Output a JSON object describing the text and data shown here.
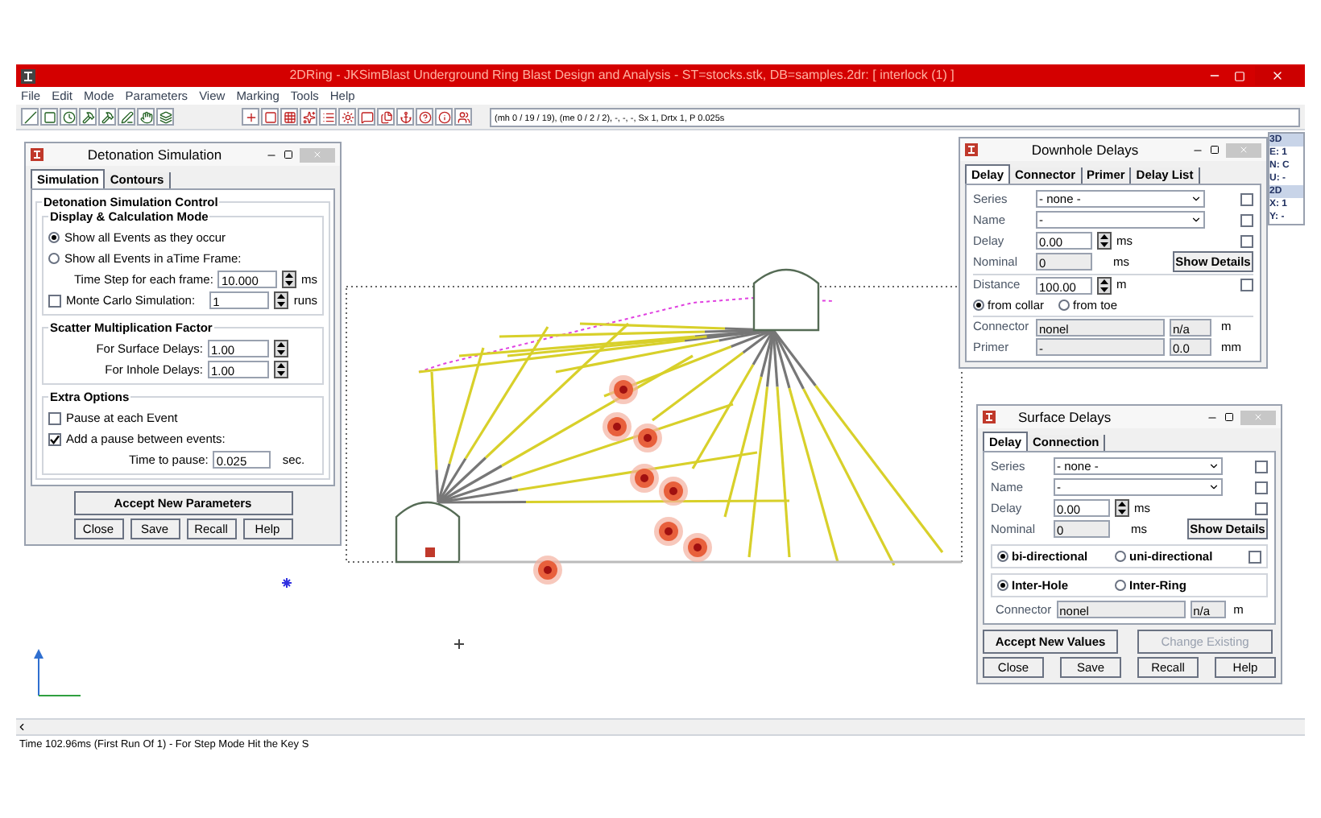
{
  "window": {
    "title": "2DRing - JKSimBlast Underground Ring Blast Design and Analysis - ST=stocks.stk, DB=samples.2dr: [ interlock (1) ]"
  },
  "menu": [
    "File",
    "Edit",
    "Mode",
    "Parameters",
    "View",
    "Marking",
    "Tools",
    "Help"
  ],
  "toolbar": {
    "status": "(mh 0 / 19 / 19), (me 0 / 2 / 2), -, -, -, Sx 1, Drtx 1, P 0.025s"
  },
  "coordinate_panel": {
    "lines": [
      {
        "text": "3D",
        "kind": "header"
      },
      {
        "text": "E: 1",
        "kind": "line"
      },
      {
        "text": "N: C",
        "kind": "line"
      },
      {
        "text": "U: -",
        "kind": "line"
      },
      {
        "text": "2D",
        "kind": "header"
      },
      {
        "text": "X: 1",
        "kind": "line"
      },
      {
        "text": "Y: -",
        "kind": "line"
      }
    ]
  },
  "detonation": {
    "title": "Detonation Simulation",
    "tabs": [
      {
        "label": "Simulation",
        "selected": true
      },
      {
        "label": "Contours",
        "selected": false
      }
    ],
    "group_title": "Detonation Simulation Control",
    "mode": {
      "title": "Display & Calculation  Mode",
      "options": [
        {
          "label": "Show all Events as they occur",
          "selected": true
        },
        {
          "label": "Show all Events in aTime Frame:",
          "selected": false
        }
      ]
    },
    "time_step": {
      "label": "Time Step for each frame:",
      "value": "10.000",
      "unit": "ms"
    },
    "monte_carlo": {
      "label": "Monte Carlo Simulation:",
      "checked": false,
      "value": "1",
      "unit": "runs"
    },
    "scatter": {
      "title": "Scatter Multiplication Factor",
      "rows": [
        {
          "label": "For Surface Delays:",
          "value": "1.00"
        },
        {
          "label": "For Inhole Delays:",
          "value": "1.00"
        }
      ]
    },
    "extra": {
      "title": "Extra Options",
      "checks": [
        {
          "label": "Pause at each Event",
          "checked": false
        },
        {
          "label": "Add a pause between events:",
          "checked": true
        }
      ],
      "time_to_pause": {
        "label": "Time to pause:",
        "value": "0.025",
        "unit": "sec."
      }
    },
    "accept": "Accept New Parameters",
    "buttons": [
      "Close",
      "Save",
      "Recall",
      "Help"
    ]
  },
  "downhole": {
    "title": "Downhole Delays",
    "tabs": [
      {
        "label": "Delay",
        "selected": true
      },
      {
        "label": "Connector",
        "selected": false
      },
      {
        "label": "Primer",
        "selected": false
      },
      {
        "label": "Delay List",
        "selected": false
      }
    ],
    "series": {
      "label": "Series",
      "value": "- none -",
      "checked": false
    },
    "name": {
      "label": "Name",
      "value": "-",
      "checked": false
    },
    "delay": {
      "label": "Delay",
      "value": "0.00",
      "unit": "ms",
      "checked": false
    },
    "nominal": {
      "label": "Nominal",
      "value": "0",
      "unit": "ms"
    },
    "show_details": "Show Details",
    "distance": {
      "label": "Distance",
      "value": "100.00",
      "unit": "m",
      "checked": false
    },
    "from": [
      {
        "label": "from collar",
        "selected": true
      },
      {
        "label": "from toe",
        "selected": false
      }
    ],
    "connector": {
      "label": "Connector",
      "value": "nonel",
      "extra": "n/a",
      "unit": "m"
    },
    "primer": {
      "label": "Primer",
      "value": "-",
      "extra": "0.0",
      "unit": "mm"
    }
  },
  "surface": {
    "title": "Surface Delays",
    "tabs": [
      {
        "label": "Delay",
        "selected": true
      },
      {
        "label": "Connection",
        "selected": false
      }
    ],
    "series": {
      "label": "Series",
      "value": "- none -",
      "checked": false
    },
    "name": {
      "label": "Name",
      "value": "-",
      "checked": false
    },
    "delay": {
      "label": "Delay",
      "value": "0.00",
      "unit": "ms",
      "checked": false
    },
    "nominal": {
      "label": "Nominal",
      "value": "0",
      "unit": "ms"
    },
    "show_details": "Show Details",
    "direction": {
      "options": [
        {
          "label": "bi-directional",
          "selected": true
        },
        {
          "label": "uni-directional",
          "selected": false
        }
      ],
      "checked": false
    },
    "link": [
      {
        "label": "Inter-Hole",
        "selected": true
      },
      {
        "label": "Inter-Ring",
        "selected": false
      }
    ],
    "connector": {
      "label": "Connector",
      "value": "nonel",
      "extra": "n/a",
      "unit": "m"
    },
    "accept": "Accept New Values",
    "change_existing": {
      "label": "Change Existing",
      "disabled": true
    },
    "buttons": [
      "Close",
      "Save",
      "Recall",
      "Help"
    ]
  },
  "status_bar": "Time 102.96ms (First Run Of 1) - For Step Mode Hit the Key S"
}
